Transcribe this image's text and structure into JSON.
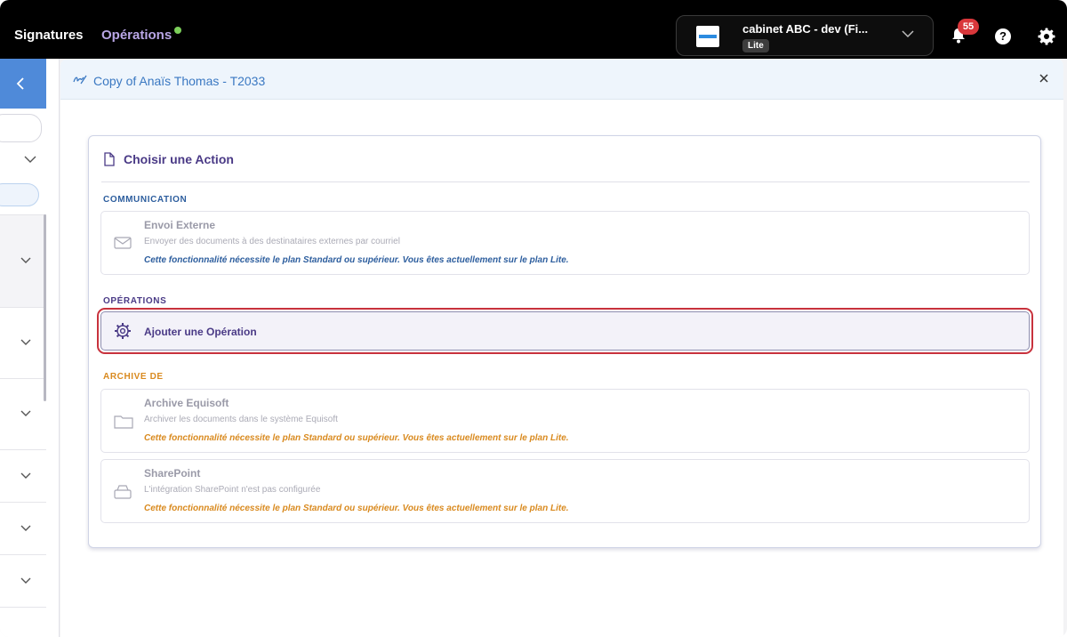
{
  "topbar": {
    "nav": {
      "signatures": "Signatures",
      "operations": "Opérations"
    },
    "account": {
      "name": "cabinet ABC - dev (Fi...",
      "plan": "Lite"
    },
    "notifications_count": "55",
    "help_label": "?"
  },
  "panel": {
    "title": "Copy of Anaïs Thomas - T2033"
  },
  "card": {
    "title": "Choisir une Action",
    "sections": {
      "communication": "COMMUNICATION",
      "operations": "OPÉRATIONS",
      "archive": "ARCHIVE DE"
    },
    "envoi": {
      "title": "Envoi Externe",
      "desc": "Envoyer des documents à des destinataires externes par courriel",
      "warning": "Cette fonctionnalité nécessite le plan Standard ou supérieur. Vous êtes actuellement sur le plan Lite."
    },
    "ajouter": {
      "title": "Ajouter une Opération"
    },
    "equisoft": {
      "title": "Archive Equisoft",
      "desc": "Archiver les documents dans le système Equisoft",
      "warning": "Cette fonctionnalité nécessite le plan Standard ou supérieur. Vous êtes actuellement sur le plan Lite."
    },
    "sharepoint": {
      "title": "SharePoint",
      "desc": "L'intégration SharePoint n'est pas configurée",
      "warning": "Cette fonctionnalité nécessite le plan Standard ou supérieur. Vous êtes actuellement sur le plan Lite."
    }
  },
  "colors": {
    "accent_purple": "#4a3a86",
    "link_blue": "#3a78c2",
    "warning_blue": "#2d5e9e",
    "warning_orange": "#d98a1f",
    "highlight_red": "#c8323d"
  },
  "icons": [
    "signature-icon",
    "close-icon",
    "document-icon",
    "mail-icon",
    "gear-icon",
    "folder-icon",
    "drive-icon",
    "bell-icon",
    "chevron-down-icon",
    "chevron-left-icon"
  ]
}
